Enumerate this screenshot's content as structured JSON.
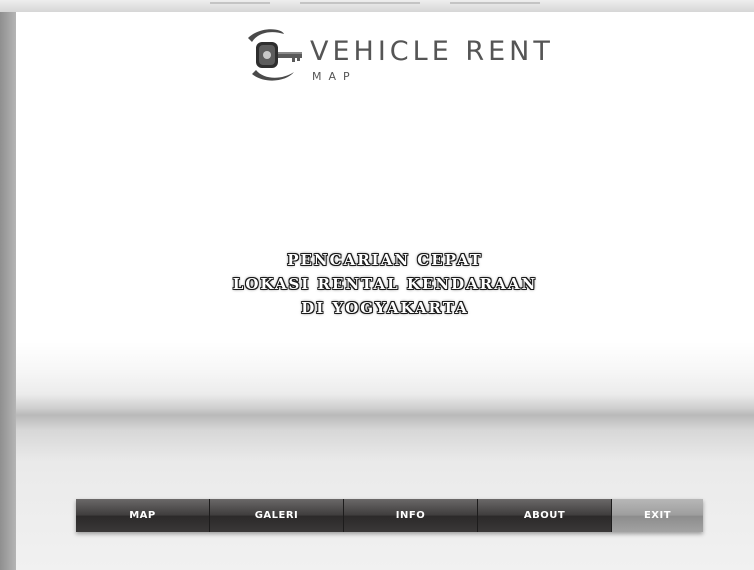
{
  "logo": {
    "title": "VEHICLE RENT",
    "subtitle": "MAP",
    "icon": "car-key-icon"
  },
  "tagline": {
    "line1": "PENCARIAN CEPAT",
    "line2": "LOKASI RENTAL KENDARAAN",
    "line3": "DI YOGYAKARTA"
  },
  "nav": {
    "map_label": "MAP",
    "galeri_label": "GALERI",
    "info_label": "INFO",
    "about_label": "ABOUT",
    "exit_label": "EXIT"
  },
  "colors": {
    "nav_dark": "#3e3c3c",
    "nav_exit": "#9d9d9d",
    "logo_text": "#555555"
  }
}
